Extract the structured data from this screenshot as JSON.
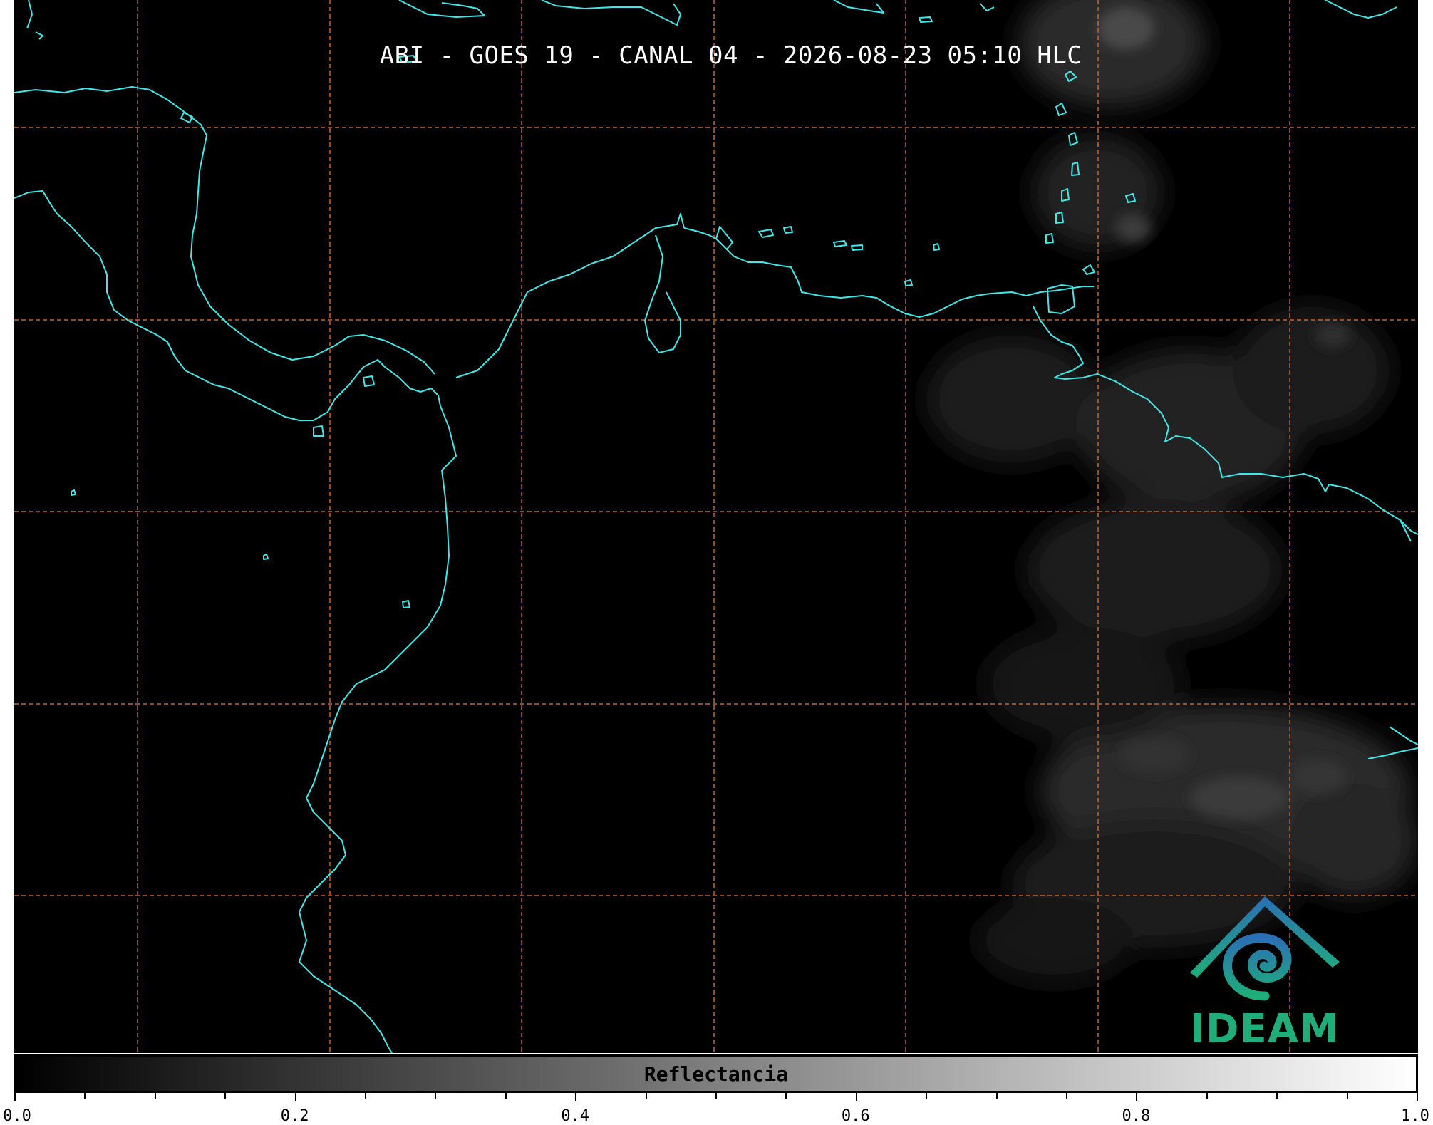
{
  "title": "ABI - GOES 19 - CANAL 04 - 2026-08-23 05:10 HLC",
  "colorbar": {
    "label": "Reflectancia",
    "min": 0.0,
    "max": 1.0,
    "tick_labels": [
      "0.0",
      "0.2",
      "0.4",
      "0.6",
      "0.8",
      "1.0"
    ],
    "major_ticks": [
      0.0,
      0.2,
      0.4,
      0.6,
      0.8,
      1.0
    ],
    "minor_step": 0.05
  },
  "map": {
    "background": "#000000",
    "coastline_color": "#3fe8e8",
    "grid_color": "#c8622a",
    "grid_style": "dashed"
  },
  "logo": {
    "text": "IDEAM",
    "icon": "ideam-logo-icon",
    "color_top": "#2a6fb5",
    "color_bottom": "#1fae7a"
  }
}
